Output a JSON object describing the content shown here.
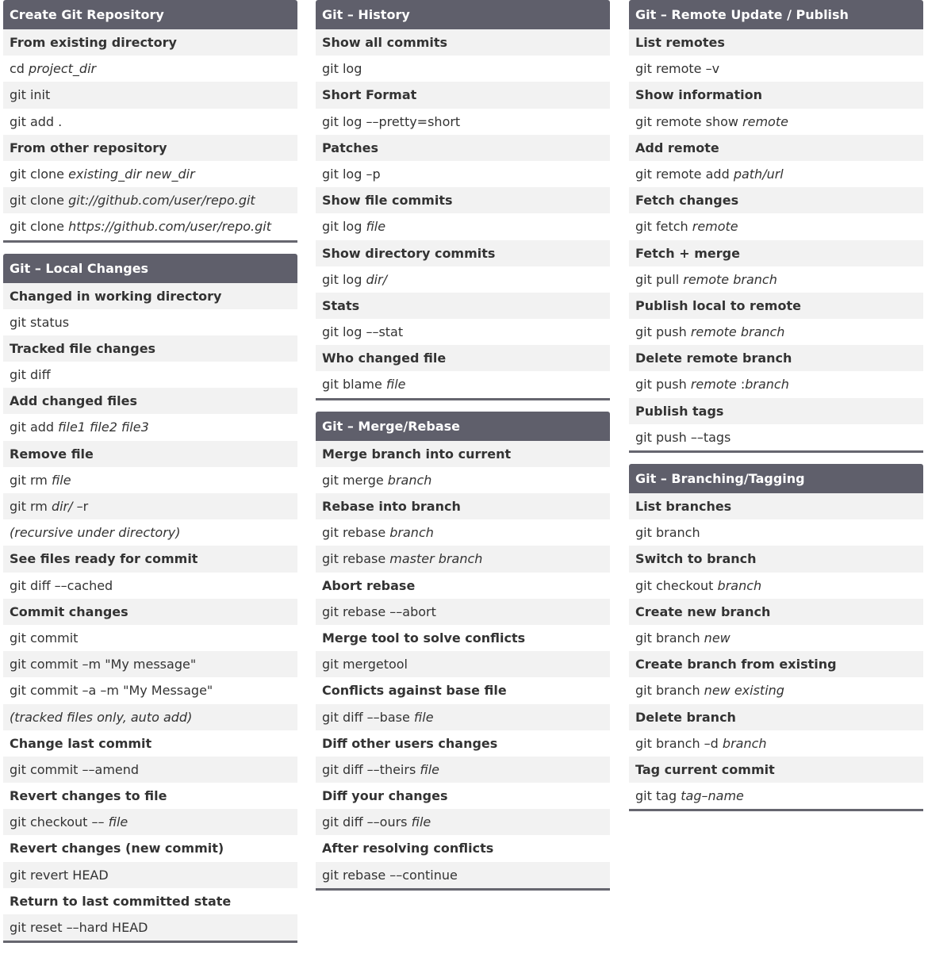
{
  "columns": [
    [
      {
        "title": "Create Git Repository",
        "rows": [
          {
            "type": "heading",
            "segs": [
              {
                "t": "From existing directory"
              }
            ]
          },
          {
            "type": "cmd",
            "segs": [
              {
                "t": "cd "
              },
              {
                "t": "project_dir",
                "i": true
              }
            ]
          },
          {
            "type": "cmd",
            "segs": [
              {
                "t": "git init"
              }
            ]
          },
          {
            "type": "cmd",
            "segs": [
              {
                "t": "git add ."
              }
            ]
          },
          {
            "type": "heading",
            "segs": [
              {
                "t": "From other repository"
              }
            ]
          },
          {
            "type": "cmd",
            "segs": [
              {
                "t": "git clone "
              },
              {
                "t": "existing_dir new_dir",
                "i": true
              }
            ]
          },
          {
            "type": "cmd",
            "segs": [
              {
                "t": "git clone "
              },
              {
                "t": "git://github.com/user/repo.git",
                "i": true
              }
            ]
          },
          {
            "type": "cmd",
            "segs": [
              {
                "t": "git clone "
              },
              {
                "t": "https://github.com/user/repo.git",
                "i": true
              }
            ]
          }
        ]
      },
      {
        "title": "Git – Local Changes",
        "rows": [
          {
            "type": "heading",
            "segs": [
              {
                "t": "Changed in working directory"
              }
            ]
          },
          {
            "type": "cmd",
            "segs": [
              {
                "t": "git status"
              }
            ]
          },
          {
            "type": "heading",
            "segs": [
              {
                "t": "Tracked file changes"
              }
            ]
          },
          {
            "type": "cmd",
            "segs": [
              {
                "t": "git diff"
              }
            ]
          },
          {
            "type": "heading",
            "segs": [
              {
                "t": "Add changed files"
              }
            ]
          },
          {
            "type": "cmd",
            "segs": [
              {
                "t": "git add "
              },
              {
                "t": "file1 file2 file3",
                "i": true
              }
            ]
          },
          {
            "type": "heading",
            "segs": [
              {
                "t": "Remove file"
              }
            ]
          },
          {
            "type": "cmd",
            "segs": [
              {
                "t": "git rm "
              },
              {
                "t": "file",
                "i": true
              }
            ]
          },
          {
            "type": "cmd",
            "segs": [
              {
                "t": "git rm "
              },
              {
                "t": "dir/",
                "i": true
              },
              {
                "t": " –r"
              }
            ]
          },
          {
            "type": "cmd",
            "segs": [
              {
                "t": "(recursive under directory)",
                "i": true
              }
            ]
          },
          {
            "type": "heading",
            "segs": [
              {
                "t": "See files ready for commit"
              }
            ]
          },
          {
            "type": "cmd",
            "segs": [
              {
                "t": "git diff ––cached"
              }
            ]
          },
          {
            "type": "heading",
            "segs": [
              {
                "t": "Commit changes"
              }
            ]
          },
          {
            "type": "cmd",
            "segs": [
              {
                "t": "git commit"
              }
            ]
          },
          {
            "type": "cmd",
            "segs": [
              {
                "t": "git commit –m \"My message\""
              }
            ]
          },
          {
            "type": "cmd",
            "segs": [
              {
                "t": "git commit –a –m \"My Message\""
              }
            ]
          },
          {
            "type": "cmd",
            "segs": [
              {
                "t": "(tracked files only, auto add)",
                "i": true
              }
            ]
          },
          {
            "type": "heading",
            "segs": [
              {
                "t": "Change last commit"
              }
            ]
          },
          {
            "type": "cmd",
            "segs": [
              {
                "t": "git commit ––amend"
              }
            ]
          },
          {
            "type": "heading",
            "segs": [
              {
                "t": "Revert changes to file"
              }
            ]
          },
          {
            "type": "cmd",
            "segs": [
              {
                "t": "git checkout –– "
              },
              {
                "t": "file",
                "i": true
              }
            ]
          },
          {
            "type": "heading",
            "segs": [
              {
                "t": "Revert changes (new commit)"
              }
            ]
          },
          {
            "type": "cmd",
            "segs": [
              {
                "t": "git revert HEAD"
              }
            ]
          },
          {
            "type": "heading",
            "segs": [
              {
                "t": "Return to last committed state"
              }
            ]
          },
          {
            "type": "cmd",
            "segs": [
              {
                "t": "git reset ––hard HEAD"
              }
            ]
          }
        ]
      }
    ],
    [
      {
        "title": "Git – History",
        "rows": [
          {
            "type": "heading",
            "segs": [
              {
                "t": "Show all commits"
              }
            ]
          },
          {
            "type": "cmd",
            "segs": [
              {
                "t": "git log"
              }
            ]
          },
          {
            "type": "heading",
            "segs": [
              {
                "t": "Short Format"
              }
            ]
          },
          {
            "type": "cmd",
            "segs": [
              {
                "t": "git log ––pretty=short"
              }
            ]
          },
          {
            "type": "heading",
            "segs": [
              {
                "t": "Patches"
              }
            ]
          },
          {
            "type": "cmd",
            "segs": [
              {
                "t": "git log –p"
              }
            ]
          },
          {
            "type": "heading",
            "segs": [
              {
                "t": "Show file commits"
              }
            ]
          },
          {
            "type": "cmd",
            "segs": [
              {
                "t": "git log "
              },
              {
                "t": "file",
                "i": true
              }
            ]
          },
          {
            "type": "heading",
            "segs": [
              {
                "t": "Show directory commits"
              }
            ]
          },
          {
            "type": "cmd",
            "segs": [
              {
                "t": "git log "
              },
              {
                "t": "dir/",
                "i": true
              }
            ]
          },
          {
            "type": "heading",
            "segs": [
              {
                "t": "Stats"
              }
            ]
          },
          {
            "type": "cmd",
            "segs": [
              {
                "t": "git log ––stat"
              }
            ]
          },
          {
            "type": "heading",
            "segs": [
              {
                "t": "Who changed file"
              }
            ]
          },
          {
            "type": "cmd",
            "segs": [
              {
                "t": "git blame "
              },
              {
                "t": "file",
                "i": true
              }
            ]
          }
        ]
      },
      {
        "title": "Git – Merge/Rebase",
        "rows": [
          {
            "type": "heading",
            "segs": [
              {
                "t": "Merge branch into current"
              }
            ]
          },
          {
            "type": "cmd",
            "segs": [
              {
                "t": "git merge "
              },
              {
                "t": "branch",
                "i": true
              }
            ]
          },
          {
            "type": "heading",
            "segs": [
              {
                "t": "Rebase into branch"
              }
            ]
          },
          {
            "type": "cmd",
            "segs": [
              {
                "t": "git rebase "
              },
              {
                "t": "branch",
                "i": true
              }
            ]
          },
          {
            "type": "cmd",
            "segs": [
              {
                "t": "git rebase "
              },
              {
                "t": "master branch",
                "i": true
              }
            ]
          },
          {
            "type": "heading",
            "segs": [
              {
                "t": "Abort rebase"
              }
            ]
          },
          {
            "type": "cmd",
            "segs": [
              {
                "t": "git rebase ––abort"
              }
            ]
          },
          {
            "type": "heading",
            "segs": [
              {
                "t": "Merge tool to solve conflicts"
              }
            ]
          },
          {
            "type": "cmd",
            "segs": [
              {
                "t": "git mergetool"
              }
            ]
          },
          {
            "type": "heading",
            "segs": [
              {
                "t": "Conflicts against base file"
              }
            ]
          },
          {
            "type": "cmd",
            "segs": [
              {
                "t": "git diff ––base "
              },
              {
                "t": "file",
                "i": true
              }
            ]
          },
          {
            "type": "heading",
            "segs": [
              {
                "t": "Diff other users changes"
              }
            ]
          },
          {
            "type": "cmd",
            "segs": [
              {
                "t": "git diff ––theirs "
              },
              {
                "t": "file",
                "i": true
              }
            ]
          },
          {
            "type": "heading",
            "segs": [
              {
                "t": "Diff your changes"
              }
            ]
          },
          {
            "type": "cmd",
            "segs": [
              {
                "t": "git diff ––ours "
              },
              {
                "t": "file",
                "i": true
              }
            ]
          },
          {
            "type": "heading",
            "segs": [
              {
                "t": "After resolving conflicts"
              }
            ]
          },
          {
            "type": "cmd",
            "segs": [
              {
                "t": "git rebase ––continue"
              }
            ]
          }
        ]
      }
    ],
    [
      {
        "title": "Git – Remote Update / Publish",
        "rows": [
          {
            "type": "heading",
            "segs": [
              {
                "t": "List remotes"
              }
            ]
          },
          {
            "type": "cmd",
            "segs": [
              {
                "t": "git remote –v"
              }
            ]
          },
          {
            "type": "heading",
            "segs": [
              {
                "t": "Show information"
              }
            ]
          },
          {
            "type": "cmd",
            "segs": [
              {
                "t": "git remote show "
              },
              {
                "t": "remote",
                "i": true
              }
            ]
          },
          {
            "type": "heading",
            "segs": [
              {
                "t": "Add remote"
              }
            ]
          },
          {
            "type": "cmd",
            "segs": [
              {
                "t": "git remote add "
              },
              {
                "t": "path/url",
                "i": true
              }
            ]
          },
          {
            "type": "heading",
            "segs": [
              {
                "t": "Fetch changes"
              }
            ]
          },
          {
            "type": "cmd",
            "segs": [
              {
                "t": "git fetch "
              },
              {
                "t": "remote",
                "i": true
              }
            ]
          },
          {
            "type": "heading",
            "segs": [
              {
                "t": "Fetch + merge"
              }
            ]
          },
          {
            "type": "cmd",
            "segs": [
              {
                "t": "git pull "
              },
              {
                "t": "remote branch",
                "i": true
              }
            ]
          },
          {
            "type": "heading",
            "segs": [
              {
                "t": "Publish local to remote"
              }
            ]
          },
          {
            "type": "cmd",
            "segs": [
              {
                "t": "git push "
              },
              {
                "t": "remote branch",
                "i": true
              }
            ]
          },
          {
            "type": "heading",
            "segs": [
              {
                "t": "Delete remote branch"
              }
            ]
          },
          {
            "type": "cmd",
            "segs": [
              {
                "t": "git push "
              },
              {
                "t": "remote",
                "i": true
              },
              {
                "t": " :"
              },
              {
                "t": "branch",
                "i": true
              }
            ]
          },
          {
            "type": "heading",
            "segs": [
              {
                "t": "Publish tags"
              }
            ]
          },
          {
            "type": "cmd",
            "segs": [
              {
                "t": "git push ––tags"
              }
            ]
          }
        ]
      },
      {
        "title": "Git – Branching/Tagging",
        "rows": [
          {
            "type": "heading",
            "segs": [
              {
                "t": "List branches"
              }
            ]
          },
          {
            "type": "cmd",
            "segs": [
              {
                "t": "git branch"
              }
            ]
          },
          {
            "type": "heading",
            "segs": [
              {
                "t": "Switch to branch"
              }
            ]
          },
          {
            "type": "cmd",
            "segs": [
              {
                "t": "git checkout "
              },
              {
                "t": "branch",
                "i": true
              }
            ]
          },
          {
            "type": "heading",
            "segs": [
              {
                "t": "Create new branch"
              }
            ]
          },
          {
            "type": "cmd",
            "segs": [
              {
                "t": "git branch "
              },
              {
                "t": "new",
                "i": true
              }
            ]
          },
          {
            "type": "heading",
            "segs": [
              {
                "t": "Create branch from existing"
              }
            ]
          },
          {
            "type": "cmd",
            "segs": [
              {
                "t": "git branch "
              },
              {
                "t": "new existing",
                "i": true
              }
            ]
          },
          {
            "type": "heading",
            "segs": [
              {
                "t": "Delete branch"
              }
            ]
          },
          {
            "type": "cmd",
            "segs": [
              {
                "t": "git branch –d "
              },
              {
                "t": "branch",
                "i": true
              }
            ]
          },
          {
            "type": "heading",
            "segs": [
              {
                "t": "Tag current commit"
              }
            ]
          },
          {
            "type": "cmd",
            "segs": [
              {
                "t": "git tag "
              },
              {
                "t": "tag–name",
                "i": true
              }
            ]
          }
        ]
      }
    ]
  ]
}
